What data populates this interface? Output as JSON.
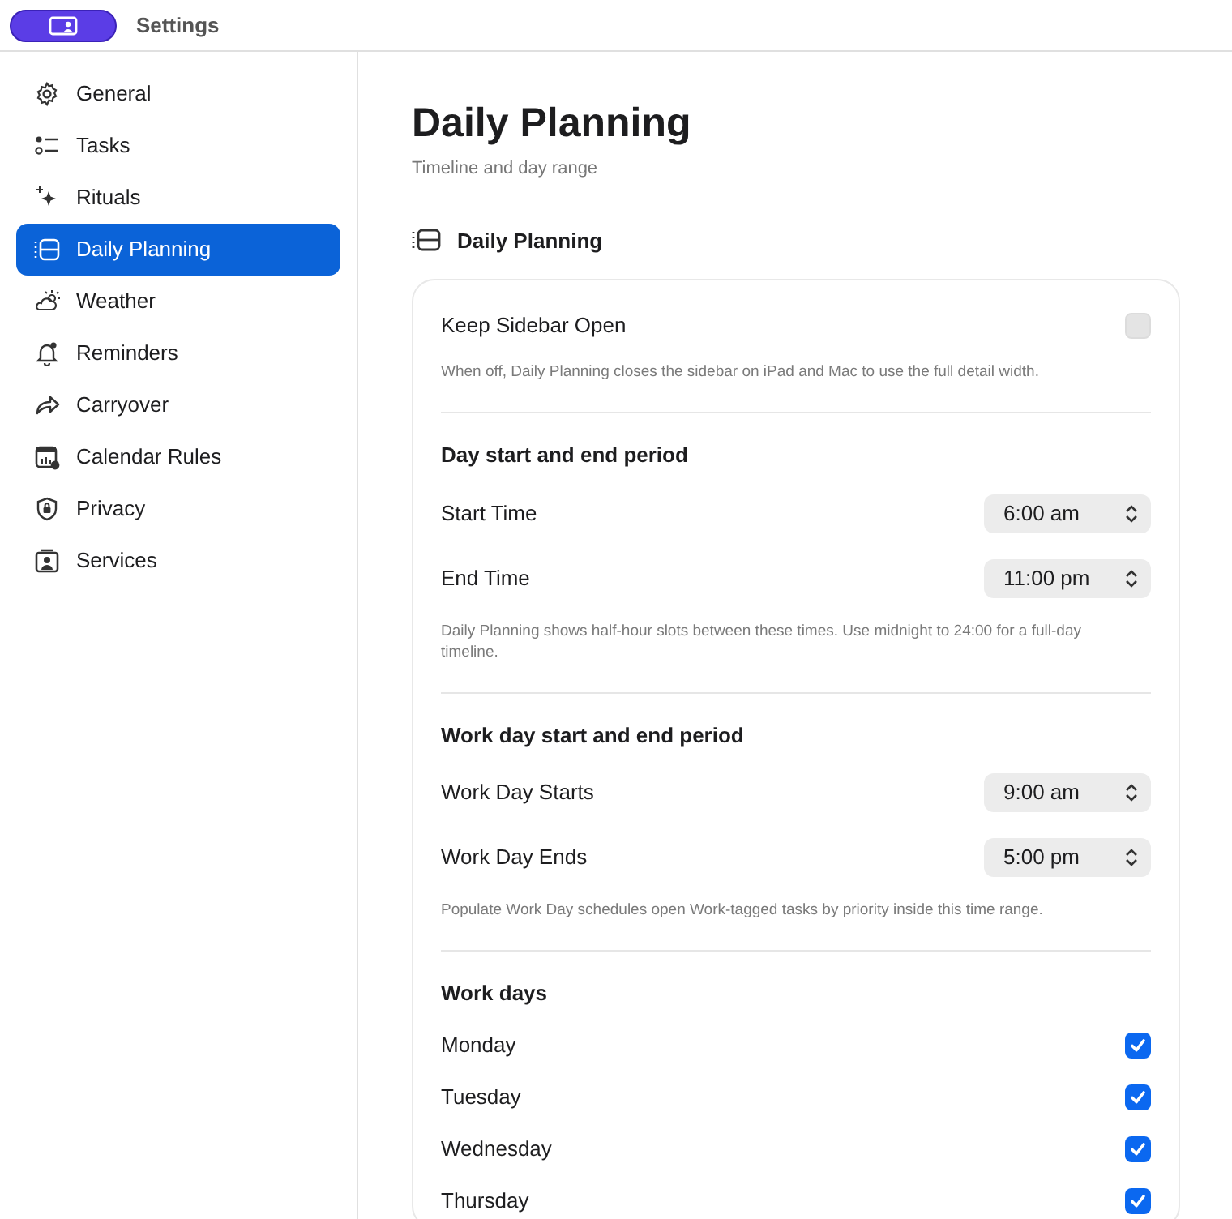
{
  "window": {
    "title": "Settings"
  },
  "sidebar": {
    "items": [
      {
        "label": "General",
        "selected": false
      },
      {
        "label": "Tasks",
        "selected": false
      },
      {
        "label": "Rituals",
        "selected": false
      },
      {
        "label": "Daily Planning",
        "selected": true
      },
      {
        "label": "Weather",
        "selected": false
      },
      {
        "label": "Reminders",
        "selected": false
      },
      {
        "label": "Carryover",
        "selected": false
      },
      {
        "label": "Calendar Rules",
        "selected": false
      },
      {
        "label": "Privacy",
        "selected": false
      },
      {
        "label": "Services",
        "selected": false
      }
    ]
  },
  "page": {
    "title": "Daily Planning",
    "subtitle": "Timeline and day range",
    "section_title": "Daily Planning"
  },
  "groups": [
    {
      "rows": [
        {
          "kind": "toggle",
          "label": "Keep Sidebar Open",
          "checked": false
        }
      ],
      "note": "When off, Daily Planning closes the sidebar on iPad and Mac to use the full detail width."
    },
    {
      "heading": "Day start and end period",
      "rows": [
        {
          "kind": "time",
          "label": "Start Time",
          "value": "6:00 am"
        },
        {
          "kind": "time",
          "label": "End Time",
          "value": "11:00 pm"
        }
      ],
      "note": "Daily Planning shows half-hour slots between these times. Use midnight to 24:00 for a full-day timeline."
    },
    {
      "heading": "Work day start and end period",
      "rows": [
        {
          "kind": "time",
          "label": "Work Day Starts",
          "value": "9:00 am"
        },
        {
          "kind": "time",
          "label": "Work Day Ends",
          "value": "5:00 pm"
        }
      ],
      "note": "Populate Work Day schedules open Work-tagged tasks by priority inside this time range."
    },
    {
      "heading": "Work days",
      "rows": [
        {
          "kind": "check",
          "label": "Monday",
          "checked": true
        },
        {
          "kind": "check",
          "label": "Tuesday",
          "checked": true
        },
        {
          "kind": "check",
          "label": "Wednesday",
          "checked": true
        },
        {
          "kind": "check",
          "label": "Thursday",
          "checked": true
        }
      ]
    }
  ]
}
